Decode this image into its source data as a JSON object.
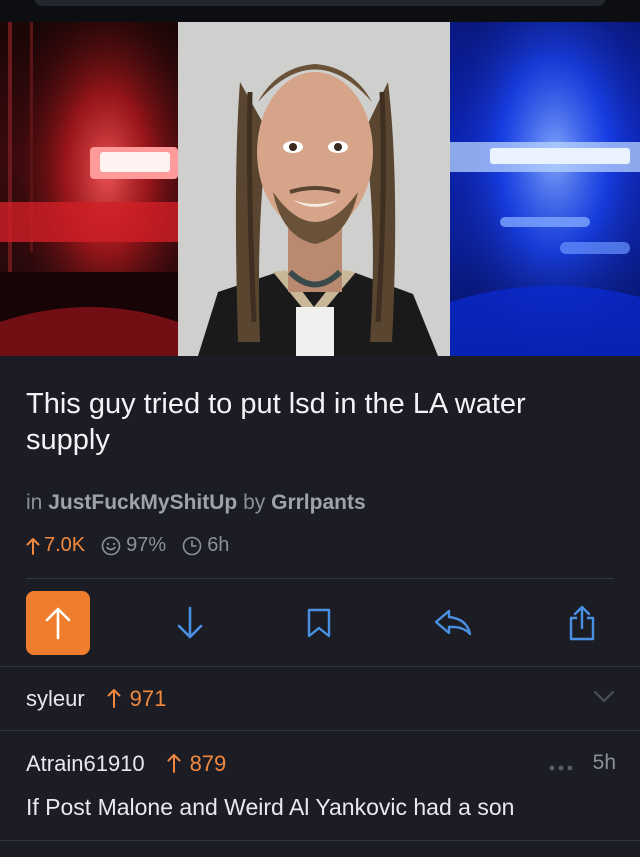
{
  "post": {
    "title": "This guy tried to put lsd in the LA water supply",
    "meta_in": "in",
    "subreddit": "JustFuckMyShitUp",
    "meta_by": "by",
    "author": "Grrlpants",
    "upvotes": "7.0K",
    "ratio": "97%",
    "age": "6h"
  },
  "actions": {
    "upvote_icon": "upvote-arrow-icon",
    "downvote_icon": "downvote-arrow-icon",
    "save_icon": "bookmark-icon",
    "reply_icon": "reply-icon",
    "share_icon": "share-icon"
  },
  "comments": [
    {
      "user": "syleur",
      "score": "971"
    },
    {
      "user": "Atrain61910",
      "score": "879",
      "age": "5h",
      "text": "If Post Malone and Weird Al Yankovic had a son"
    }
  ],
  "colors": {
    "accent": "#f07d2e",
    "link_blue": "#4a90e2",
    "background": "#1c1d24"
  }
}
